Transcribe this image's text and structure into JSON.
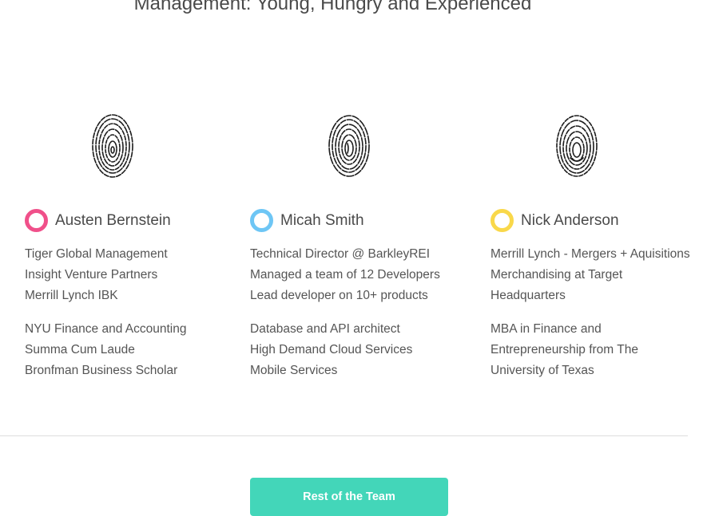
{
  "section": {
    "title": "Management: Young, Hungry and Experienced"
  },
  "people": [
    {
      "name": "Austen Bernstein",
      "ring_color": "#f0508a",
      "experience": [
        "Tiger Global Management",
        "Insight Venture Partners",
        "Merrill Lynch IBK"
      ],
      "education": [
        "NYU Finance and Accounting",
        "Summa Cum Laude",
        "Bronfman Business Scholar"
      ]
    },
    {
      "name": "Micah Smith",
      "ring_color": "#6ec6f5",
      "experience": [
        "Technical Director @ BarkleyREI",
        "Managed a team of 12 Developers",
        "Lead developer on 10+ products"
      ],
      "education": [
        "Database and API architect",
        "High Demand Cloud Services",
        "Mobile Services"
      ]
    },
    {
      "name": "Nick Anderson",
      "ring_color": "#f9d84a",
      "experience": [
        "Merrill Lynch - Mergers + Aquisitions",
        "Merchandising at Target",
        "Headquarters"
      ],
      "education": [
        "MBA in Finance and",
        "Entrepreneurship from The",
        "University of Texas"
      ]
    }
  ],
  "cta": {
    "label": "Rest of the Team",
    "color": "#43d6b9"
  },
  "icons": {
    "fingerprint": "fingerprint-icon",
    "ring": "circle-ring-icon"
  }
}
